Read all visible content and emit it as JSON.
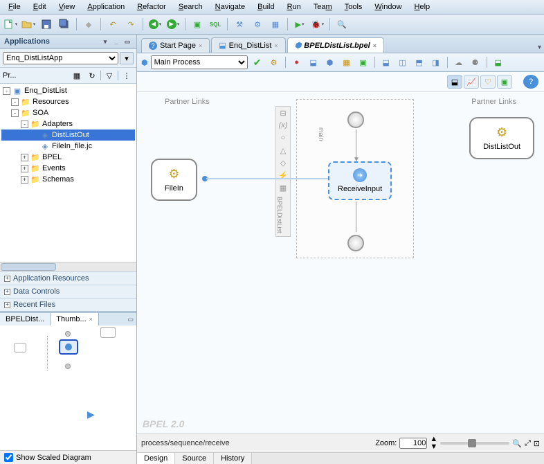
{
  "menu": [
    "File",
    "Edit",
    "View",
    "Application",
    "Refactor",
    "Search",
    "Navigate",
    "Build",
    "Run",
    "Team",
    "Tools",
    "Window",
    "Help"
  ],
  "left": {
    "title": "Applications",
    "selector": "Enq_DistListApp",
    "tree_tab": "Pr...",
    "tree": [
      {
        "lvl": 0,
        "exp": "-",
        "icon": "proj",
        "label": "Enq_DistList"
      },
      {
        "lvl": 1,
        "exp": "-",
        "icon": "folder",
        "label": "Resources"
      },
      {
        "lvl": 1,
        "exp": "-",
        "icon": "folder",
        "label": "SOA"
      },
      {
        "lvl": 2,
        "exp": "-",
        "icon": "folder-open",
        "label": "Adapters"
      },
      {
        "lvl": 3,
        "exp": "",
        "icon": "file",
        "label": "DistListOut",
        "selected": true
      },
      {
        "lvl": 3,
        "exp": "",
        "icon": "file",
        "label": "FileIn_file.jc"
      },
      {
        "lvl": 2,
        "exp": "+",
        "icon": "folder",
        "label": "BPEL"
      },
      {
        "lvl": 2,
        "exp": "+",
        "icon": "folder",
        "label": "Events"
      },
      {
        "lvl": 2,
        "exp": "+",
        "icon": "folder",
        "label": "Schemas"
      }
    ],
    "accordion": [
      "Application Resources",
      "Data Controls",
      "Recent Files"
    ],
    "thumb_tabs": [
      "BPELDist...",
      "Thumb..."
    ],
    "show_scaled": "Show Scaled Diagram"
  },
  "editor": {
    "tabs": [
      {
        "label": "Start Page",
        "icon": "?"
      },
      {
        "label": "Enq_DistList",
        "icon": "composite"
      },
      {
        "label": "BPELDistList.bpel",
        "icon": "bpel",
        "active": true
      }
    ],
    "process_selector": "Main Process",
    "partner_links_label": "Partner Links",
    "filein": "FileIn",
    "receive": "ReceiveInput",
    "distlistout": "DistListOut",
    "main_label": "main",
    "bpel_process_label": "BPELDistList",
    "bpel_version": "BPEL 2.0",
    "breadcrumb": "process/sequence/receive",
    "zoom_label": "Zoom:",
    "zoom_value": "100",
    "bottom_tabs": [
      "Design",
      "Source",
      "History"
    ]
  }
}
